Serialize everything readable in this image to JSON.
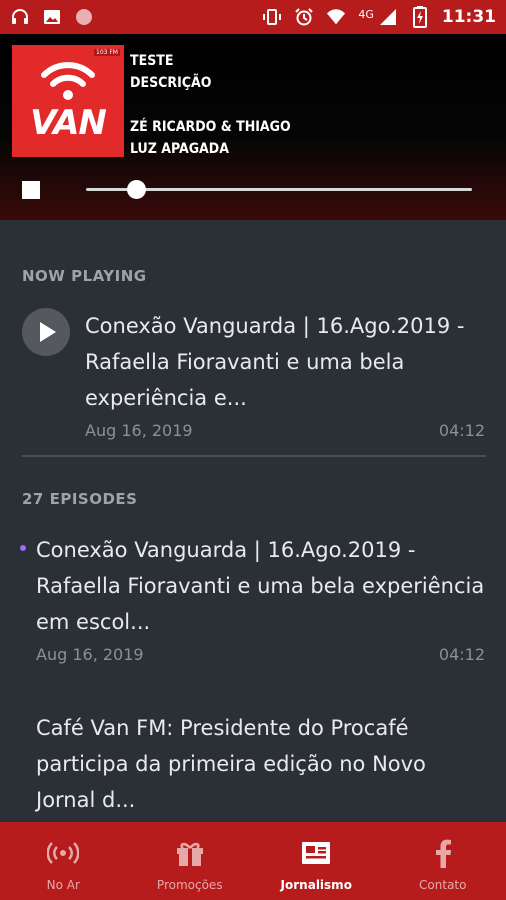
{
  "status_bar": {
    "time": "11:31",
    "network": "4G",
    "icons_left": [
      "headphones-icon",
      "image-icon",
      "record-icon"
    ],
    "icons_right": [
      "vibrate-icon",
      "alarm-icon",
      "wifi-icon",
      "signal-icon",
      "battery-charging-icon"
    ]
  },
  "player": {
    "logo_text": "VAN",
    "logo_badge": "103 FM",
    "line1": "TESTE",
    "line2": "DESCRIÇÃO",
    "line3": "ZÉ RICARDO & THIAGO",
    "line4": "LUZ APAGADA",
    "progress": 0.13
  },
  "now_playing": {
    "label": "NOW PLAYING",
    "title": "Conexão Vanguarda | 16.Ago.2019 - Rafaella Fioravanti e uma bela experiência e...",
    "date": "Aug 16, 2019",
    "duration": "04:12"
  },
  "episodes": {
    "label": "27 EPISODES",
    "items": [
      {
        "title": "Conexão Vanguarda | 16.Ago.2019 - Rafaella Fioravanti e uma bela experiência em escol...",
        "date": "Aug 16, 2019",
        "duration": "04:12"
      },
      {
        "title": "Café Van FM: Presidente do Procafé participa da primeira edição no Novo Jornal d..."
      }
    ]
  },
  "nav": {
    "items": [
      {
        "label": "No Ar",
        "icon": "broadcast-icon"
      },
      {
        "label": "Promoções",
        "icon": "gift-icon"
      },
      {
        "label": "Jornalismo",
        "icon": "news-icon"
      },
      {
        "label": "Contato",
        "icon": "facebook-icon"
      }
    ],
    "active": "Jornalismo",
    "active_color": "#ffffff",
    "inactive_color": "#e7a8a8",
    "bar_color": "#b71c1c"
  }
}
